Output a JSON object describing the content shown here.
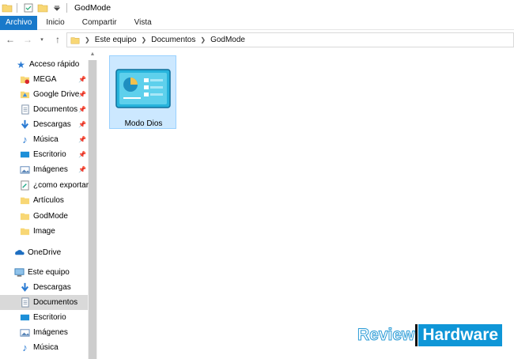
{
  "window": {
    "title": "GodMode"
  },
  "ribbon": {
    "tabs": [
      "Archivo",
      "Inicio",
      "Compartir",
      "Vista"
    ]
  },
  "address": {
    "crumbs": [
      "Este equipo",
      "Documentos",
      "GodMode"
    ]
  },
  "sidebar": {
    "quick_access": "Acceso rápido",
    "quick_items": [
      "MEGA",
      "Google Drive",
      "Documentos",
      "Descargas",
      "Música",
      "Escritorio",
      "Imágenes",
      "¿como exportar",
      "Artículos",
      "GodMode",
      "Image"
    ],
    "onedrive": "OneDrive",
    "this_pc": "Este equipo",
    "pc_items": [
      "Descargas",
      "Documentos",
      "Escritorio",
      "Imágenes",
      "Música"
    ]
  },
  "content": {
    "items": [
      {
        "name": "Modo Dios",
        "icon": "control-panel-icon"
      }
    ]
  },
  "watermark": {
    "part1": "Review",
    "part2": "Hardware"
  },
  "colors": {
    "accent": "#1979ca",
    "selection": "#cce8ff",
    "selection_border": "#99d1ff",
    "folder": "#f8d775"
  }
}
